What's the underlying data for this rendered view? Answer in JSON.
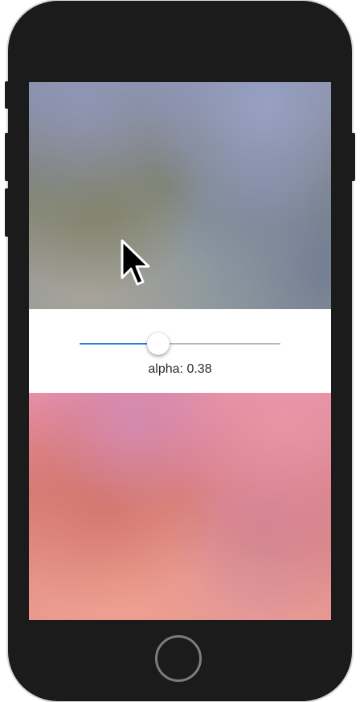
{
  "device": {
    "frame_color": "#1b1b1b",
    "home_button_color": "#7d7d7d"
  },
  "slider": {
    "value": 0.38,
    "fill_color": "#2f7ad8",
    "track_color": "#b6b6b6"
  },
  "label": {
    "text": "alpha: 0.38"
  },
  "images": {
    "top_view": "blurred-bluish-gray-photo",
    "bottom_view": "blurred-pink-photo"
  },
  "cursor": {
    "icon": "arrow-cursor-icon"
  }
}
